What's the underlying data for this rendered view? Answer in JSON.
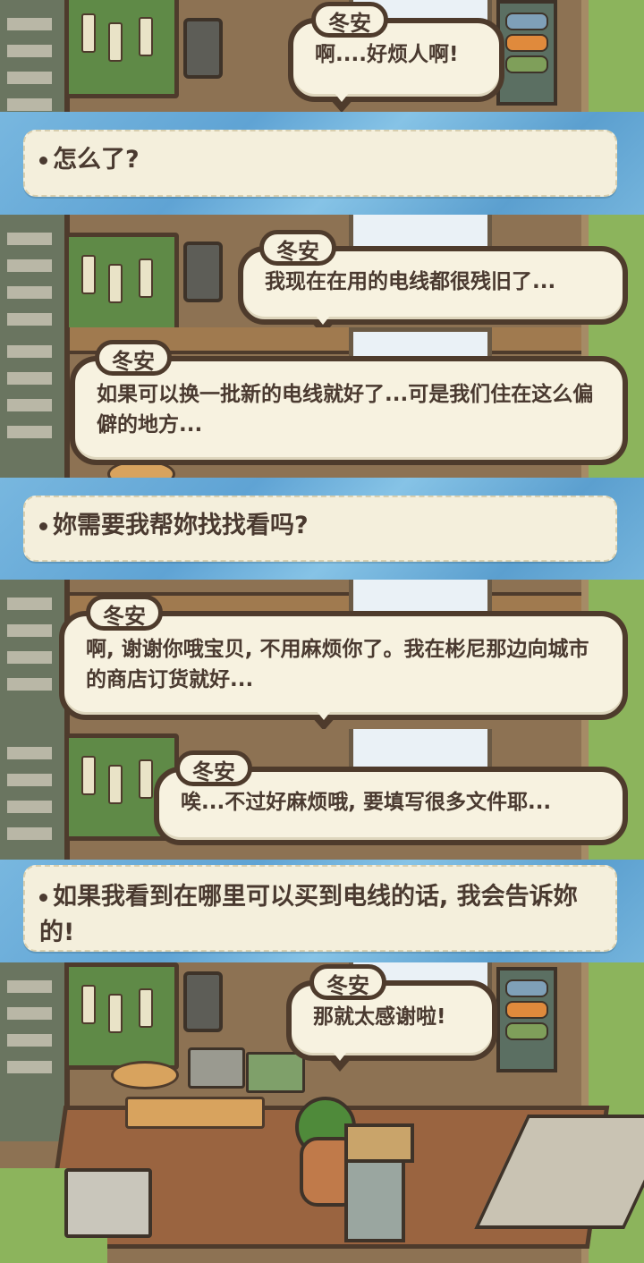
{
  "speaker": "冬安",
  "dialogue": [
    {
      "type": "npc",
      "speaker": "冬安",
      "text": "啊....好烦人啊!"
    },
    {
      "type": "choice",
      "text": "怎么了?"
    },
    {
      "type": "npc",
      "speaker": "冬安",
      "text": "我现在在用的电线都很残旧了..."
    },
    {
      "type": "npc",
      "speaker": "冬安",
      "text": "如果可以换一批新的电线就好了...可是我们住在这么偏僻的地方..."
    },
    {
      "type": "choice",
      "text": "妳需要我帮妳找找看吗?"
    },
    {
      "type": "npc",
      "speaker": "冬安",
      "text": "啊, 谢谢你哦宝贝, 不用麻烦你了。我在彬尼那边向城市的商店订货就好..."
    },
    {
      "type": "npc",
      "speaker": "冬安",
      "text": "唉...不过好麻烦哦, 要填写很多文件耶..."
    },
    {
      "type": "choice",
      "text": "如果我看到在哪里可以买到电线的话, 我会告诉妳的!"
    },
    {
      "type": "npc",
      "speaker": "冬安",
      "text": "那就太感谢啦!"
    }
  ],
  "colors": {
    "bubble_fill": "#f7f2e0",
    "bubble_border": "#4e3b2c",
    "text": "#4a3a30",
    "choice_band": "#6aaad8"
  },
  "icons": [
    "choice-bullet-icon"
  ]
}
